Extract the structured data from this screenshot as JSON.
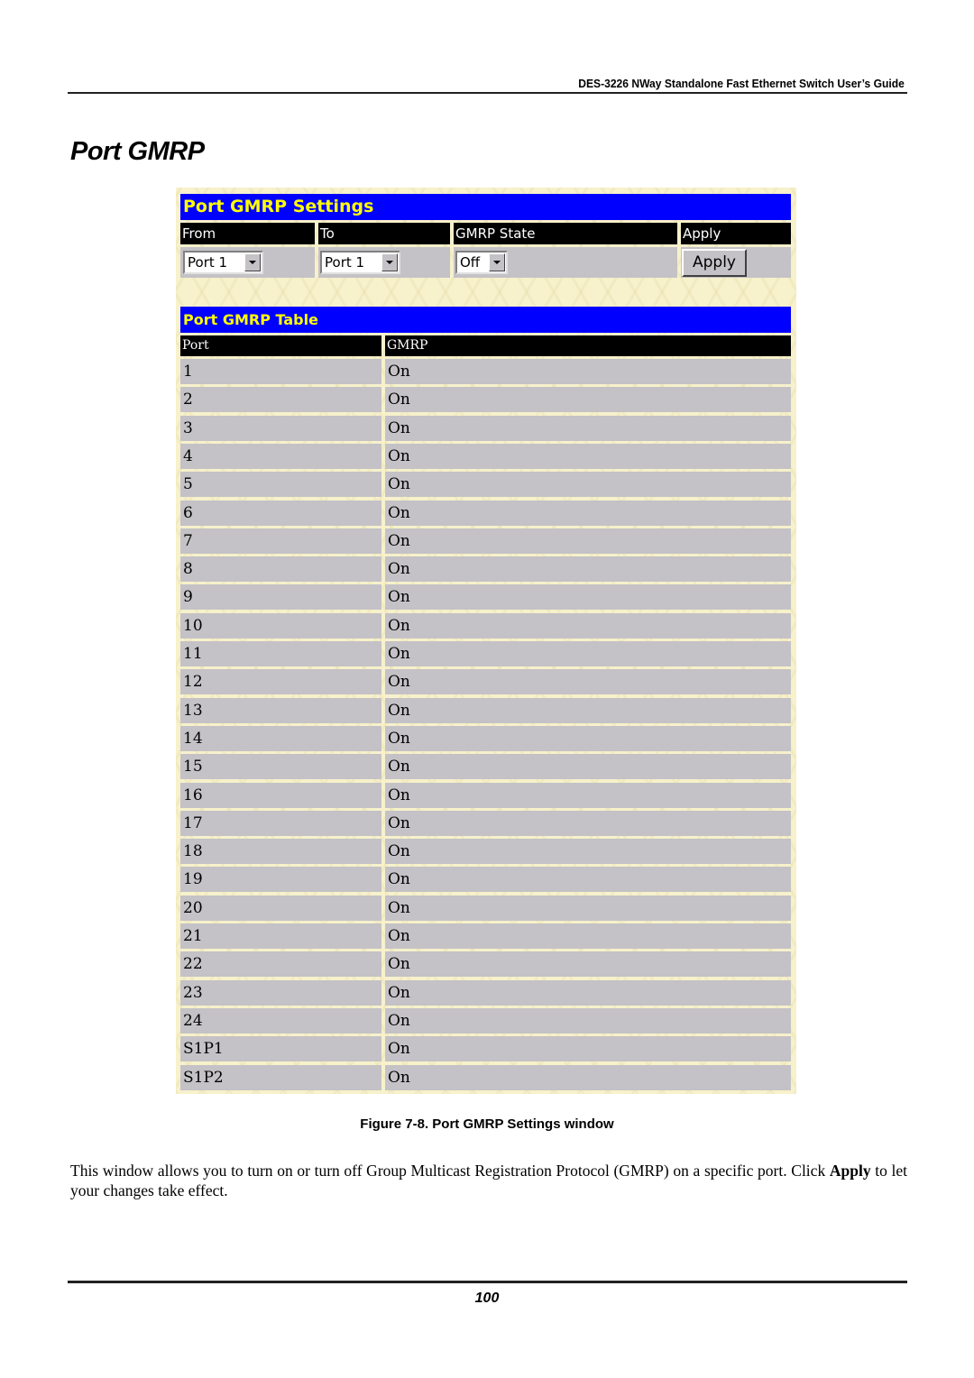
{
  "document": {
    "running_head": "DES-3226 NWay Standalone Fast Ethernet Switch User’s Guide",
    "section_title": "Port GMRP",
    "figure_caption": "Figure 7-8.  Port GMRP Settings window",
    "body_text_before": "This window allows you to turn on or turn off Group Multicast Registration Protocol (GMRP) on a specific port. Click ",
    "body_text_bold": "Apply",
    "body_text_after": " to let your changes take effect.",
    "page_number": "100"
  },
  "settings": {
    "title": "Port GMRP Settings",
    "columns": [
      "From",
      "To",
      "GMRP State",
      "Apply"
    ],
    "from_value": "Port 1",
    "to_value": "Port 1",
    "state_value": "Off",
    "apply_label": "Apply",
    "dropdown_icon": "chevron-down-icon"
  },
  "gmrp_table": {
    "title": "Port GMRP Table",
    "columns": [
      "Port",
      "GMRP"
    ],
    "rows": [
      {
        "port": "1",
        "gmrp": "On"
      },
      {
        "port": "2",
        "gmrp": "On"
      },
      {
        "port": "3",
        "gmrp": "On"
      },
      {
        "port": "4",
        "gmrp": "On"
      },
      {
        "port": "5",
        "gmrp": "On"
      },
      {
        "port": "6",
        "gmrp": "On"
      },
      {
        "port": "7",
        "gmrp": "On"
      },
      {
        "port": "8",
        "gmrp": "On"
      },
      {
        "port": "9",
        "gmrp": "On"
      },
      {
        "port": "10",
        "gmrp": "On"
      },
      {
        "port": "11",
        "gmrp": "On"
      },
      {
        "port": "12",
        "gmrp": "On"
      },
      {
        "port": "13",
        "gmrp": "On"
      },
      {
        "port": "14",
        "gmrp": "On"
      },
      {
        "port": "15",
        "gmrp": "On"
      },
      {
        "port": "16",
        "gmrp": "On"
      },
      {
        "port": "17",
        "gmrp": "On"
      },
      {
        "port": "18",
        "gmrp": "On"
      },
      {
        "port": "19",
        "gmrp": "On"
      },
      {
        "port": "20",
        "gmrp": "On"
      },
      {
        "port": "21",
        "gmrp": "On"
      },
      {
        "port": "22",
        "gmrp": "On"
      },
      {
        "port": "23",
        "gmrp": "On"
      },
      {
        "port": "24",
        "gmrp": "On"
      },
      {
        "port": "S1P1",
        "gmrp": "On"
      },
      {
        "port": "S1P2",
        "gmrp": "On"
      }
    ]
  },
  "colors": {
    "title_bar": "#0000ff",
    "title_text": "#ffff00",
    "header_bar": "#000000",
    "row_bg": "#c4c2c6",
    "panel_bg": "#f7f1cc"
  }
}
